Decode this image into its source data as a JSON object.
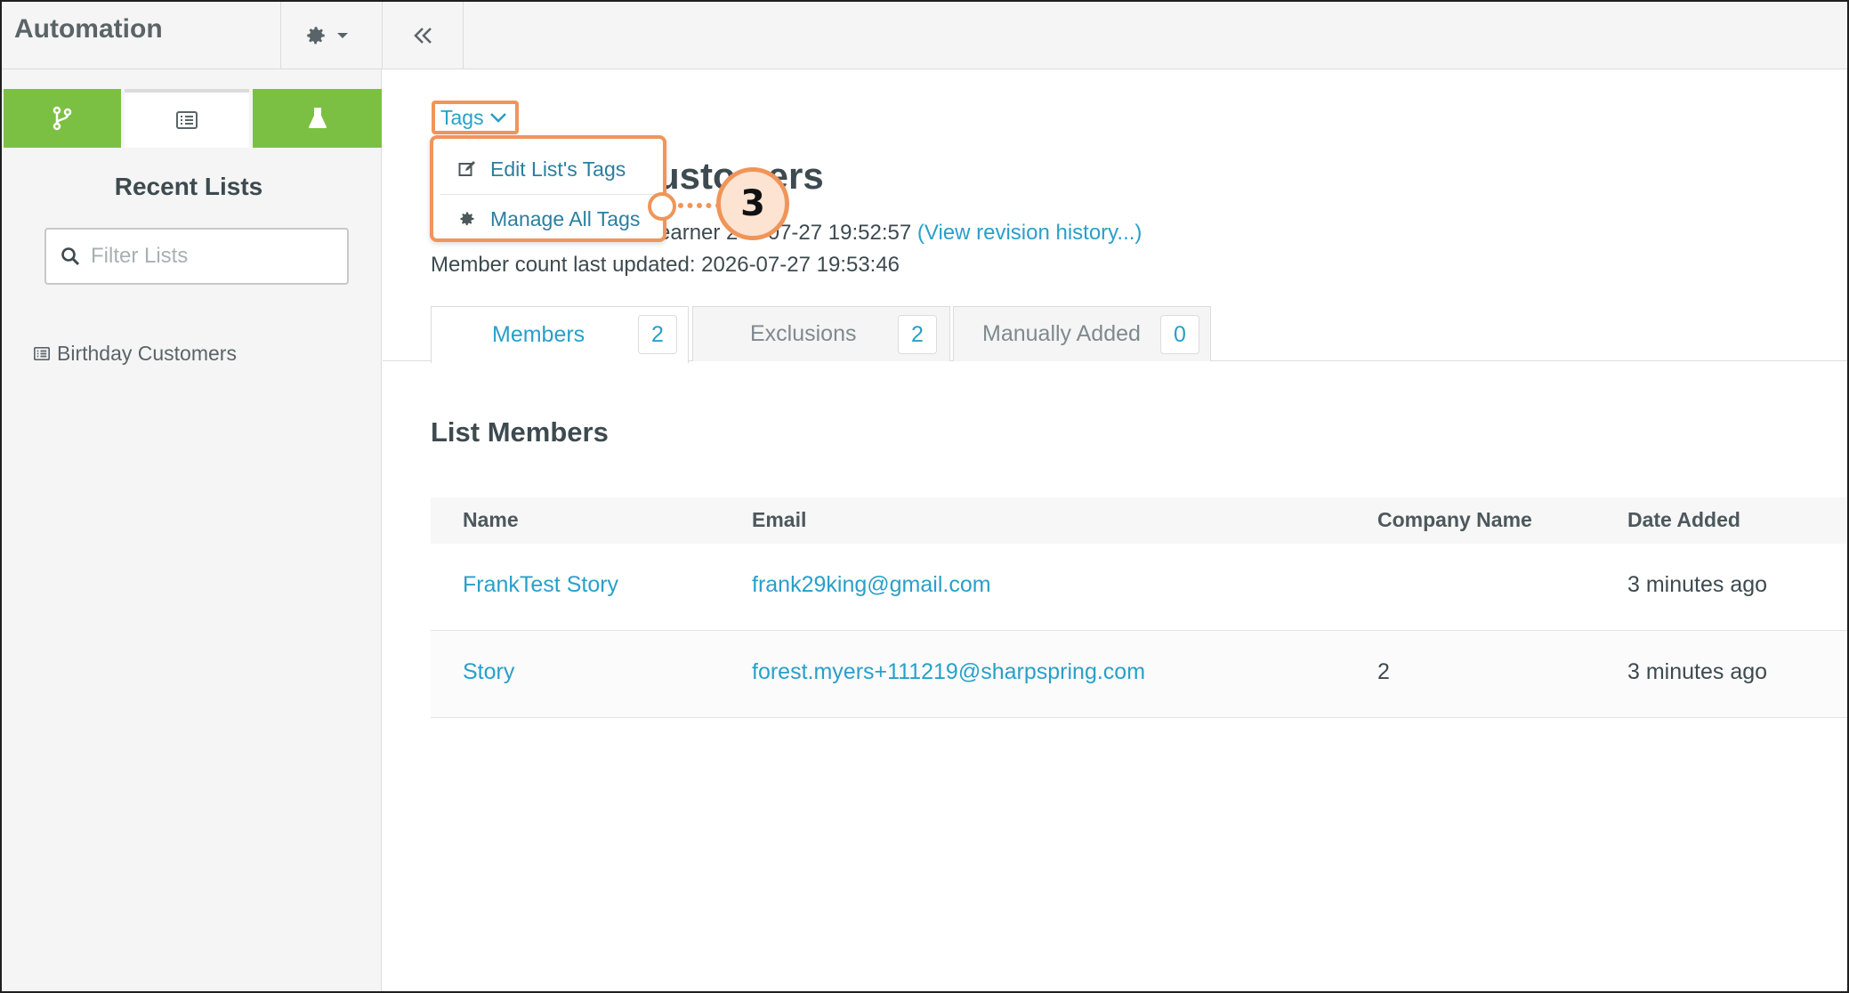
{
  "app": {
    "title": "Automation"
  },
  "sidebar": {
    "tabs": [
      {
        "name": "workflows",
        "icon": "branch-icon"
      },
      {
        "name": "lists",
        "icon": "list-icon",
        "active": true
      },
      {
        "name": "tests",
        "icon": "flask-icon"
      }
    ],
    "title": "Recent Lists",
    "filter": {
      "placeholder": "Filter Lists",
      "value": ""
    },
    "items": [
      {
        "label": "Birthday Customers"
      }
    ]
  },
  "page": {
    "title_visible": "usto",
    "title_visible_end": "ers",
    "meta_line1_prefix": "earner 2",
    "meta_line1_suffix": "6-07-27 19:52:57",
    "revision_link": "(View revision history...)",
    "member_count_line": "Member count last updated: 2026-07-27 19:53:46"
  },
  "tags": {
    "toggle_label": "Tags",
    "menu": [
      {
        "label": "Edit List's Tags",
        "icon": "edit-icon"
      },
      {
        "label": "Manage All Tags",
        "icon": "gear-icon"
      }
    ]
  },
  "callout": {
    "number": "3"
  },
  "tabs": [
    {
      "label": "Members",
      "count": "2",
      "active": true
    },
    {
      "label": "Exclusions",
      "count": "2"
    },
    {
      "label": "Manually Added",
      "count": "0"
    }
  ],
  "members": {
    "title": "List Members",
    "columns": [
      "Name",
      "Email",
      "Company Name",
      "Date Added"
    ],
    "rows": [
      {
        "name": "FrankTest Story",
        "email": "frank29king@gmail.com",
        "company": "",
        "date": "3 minutes ago"
      },
      {
        "name": "Story",
        "email": "forest.myers+111219@sharpspring.com",
        "company": "2",
        "date": "3 minutes ago"
      }
    ]
  },
  "colors": {
    "accent": "#2a9fc9",
    "green": "#7cc043",
    "highlight": "#f0955a"
  }
}
